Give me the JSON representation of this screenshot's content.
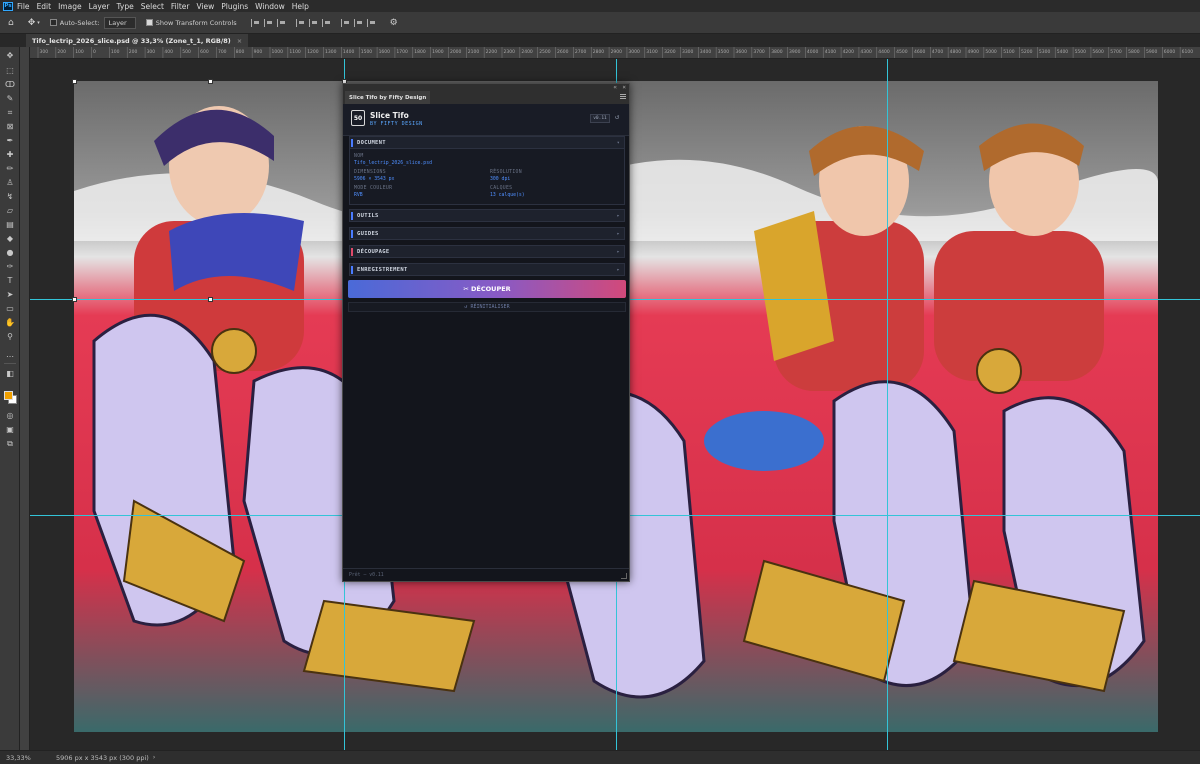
{
  "menubar": {
    "items": [
      "File",
      "Edit",
      "Image",
      "Layer",
      "Type",
      "Select",
      "Filter",
      "View",
      "Plugins",
      "Window",
      "Help"
    ]
  },
  "options": {
    "auto_select": "Auto-Select:",
    "layer_select": "Layer",
    "show_transform": "Show Transform Controls"
  },
  "document_tab": {
    "title": "Tifo_lectrip_2026_slice.psd @ 33,3% (Zone_t_1, RGB/8)",
    "close": "×"
  },
  "ruler": {
    "ticks": [
      "300",
      "200",
      "100",
      "0",
      "100",
      "200",
      "300",
      "400",
      "500",
      "600",
      "700",
      "800",
      "900",
      "1000",
      "1100",
      "1200",
      "1300",
      "1400",
      "1500",
      "1600",
      "1700",
      "1800",
      "1900",
      "2000",
      "2100",
      "2200",
      "2300",
      "2400",
      "2500",
      "2600",
      "2700",
      "2800",
      "2900",
      "3000",
      "3100",
      "3200",
      "3300",
      "3400",
      "3500",
      "3600",
      "3700",
      "3800",
      "3900",
      "4000",
      "4100",
      "4200",
      "4300",
      "4400",
      "4500",
      "4600",
      "4700",
      "4800",
      "4900",
      "5000",
      "5100",
      "5200",
      "5300",
      "5400",
      "5500",
      "5600",
      "5700",
      "5800",
      "5900",
      "6000",
      "6100"
    ]
  },
  "statusbar": {
    "zoom": "33,33%",
    "info": "5906 px x 3543 px (300 ppi)"
  },
  "plugin": {
    "tab_title": "Slice Tifo by Fifty Design",
    "collapse": "«",
    "close": "×",
    "logo": "50",
    "title": "Slice Tifo",
    "subtitle": "BY FIFTY DESIGN",
    "version": "v0.11",
    "refresh_icon": "↺",
    "sections": [
      {
        "label": "DOCUMENT",
        "color": "#4a7cff",
        "chevron": "▾"
      },
      {
        "label": "OUTILS",
        "color": "#4a7cff",
        "chevron": "▸"
      },
      {
        "label": "GUIDES",
        "color": "#4a7cff",
        "chevron": "▸"
      },
      {
        "label": "DÉCOUPAGE",
        "color": "#e04a6a",
        "chevron": "▸"
      },
      {
        "label": "ENREGISTREMENT",
        "color": "#4a7cff",
        "chevron": "▸"
      }
    ],
    "document": {
      "nom_label": "NOM",
      "nom_value": "Tifo_lectrip_2026_slice.psd",
      "dim_label": "DIMENSIONS",
      "dim_value": "5906 × 3543 px",
      "res_label": "RÉSOLUTION",
      "res_value": "300 dpi",
      "mode_label": "MODE COULEUR",
      "mode_value": "RVB",
      "calques_label": "CALQUES",
      "calques_value": "13 calque(s)"
    },
    "decouper": "✂ DÉCOUPER",
    "reinit": "↺ RÉINITIALISER",
    "footer": "Prêt — v0.11"
  }
}
